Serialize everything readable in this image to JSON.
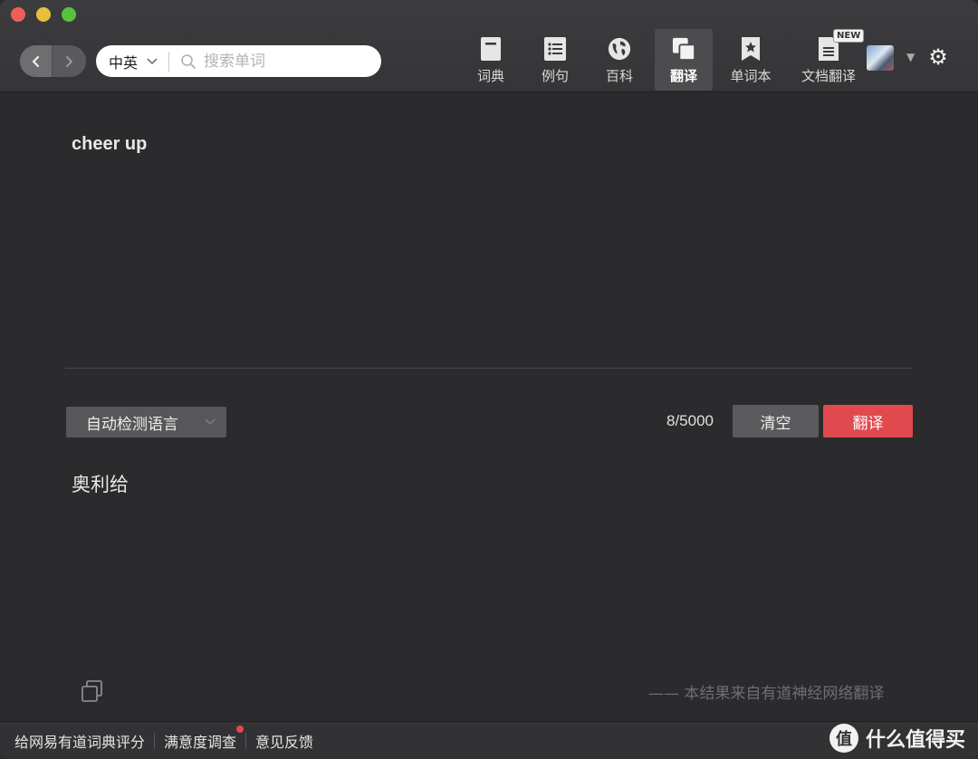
{
  "toolbar": {
    "lang_selector": "中英",
    "search_placeholder": "搜索单词",
    "tabs": [
      {
        "label": "词典",
        "icon": "book-icon"
      },
      {
        "label": "例句",
        "icon": "list-icon"
      },
      {
        "label": "百科",
        "icon": "globe-icon"
      },
      {
        "label": "翻译",
        "icon": "translate-icon",
        "active": true
      },
      {
        "label": "单词本",
        "icon": "bookmark-star-icon"
      },
      {
        "label": "文档翻译",
        "icon": "document-icon",
        "badge": "NEW"
      }
    ]
  },
  "main": {
    "source_text": "cheer up",
    "lang_detect_label": "自动检测语言",
    "char_count": "8/5000",
    "clear_label": "清空",
    "translate_label": "翻译",
    "result_text": "奥利给",
    "source_note": "—— 本结果来自有道神经网络翻译"
  },
  "bottom": {
    "links": [
      "给网易有道词典评分",
      "满意度调查",
      "意见反馈"
    ],
    "brand_text": "什么值得买",
    "brand_mark": "值"
  },
  "colors": {
    "background": "#2b2b2d",
    "accent_red": "#e04a4e",
    "button_gray": "#5b5b5e"
  }
}
